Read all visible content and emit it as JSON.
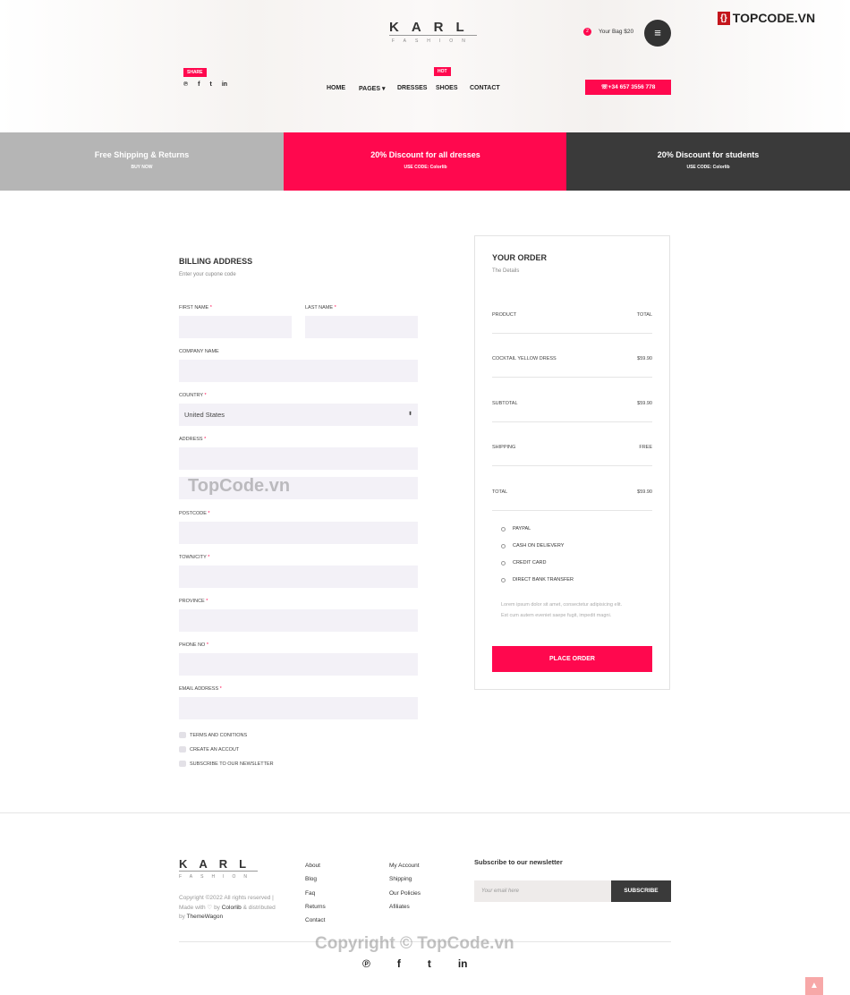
{
  "header": {
    "logo_main": "KARL",
    "logo_sub": "FASHION",
    "share_tag": "SHARE",
    "hot_tag": "HOT",
    "bag_count": "2",
    "bag_label": "Your Bag $20",
    "phone": "+34 657 3556 778",
    "nav": [
      "HOME",
      "PAGES",
      "DRESSES",
      "SHOES",
      "CONTACT"
    ],
    "social_icons": [
      "pinterest-icon",
      "facebook-icon",
      "twitter-icon",
      "linkedin-icon"
    ]
  },
  "banners": [
    {
      "title": "Free Shipping & Returns",
      "sub": "BUY NOW",
      "color": "#b5b5b5"
    },
    {
      "title": "20% Discount for all dresses",
      "sub": "USE CODE: Colorlib",
      "color": "#ff084e"
    },
    {
      "title": "20% Discount for students",
      "sub": "USE CODE: Colorlib",
      "color": "#3a3a3a"
    }
  ],
  "billing": {
    "title": "BILLING ADDRESS",
    "subtitle": "Enter your cupone code",
    "first_name": "FIRST NAME",
    "last_name": "LAST NAME",
    "company": "COMPANY NAME",
    "country": "COUNTRY",
    "country_value": "United States",
    "address": "ADDRESS",
    "postcode": "POSTCODE",
    "town": "TOWN/CITY",
    "province": "PROVINCE",
    "phone": "PHONE NO",
    "email": "EMAIL ADDRESS",
    "required": "*",
    "checkboxes": [
      "TERMS AND CONITIONS",
      "CREATE AN ACCOUT",
      "SUBSCRIBE TO OUR NEWSLETTER"
    ]
  },
  "order": {
    "title": "YOUR ORDER",
    "subtitle": "The Details",
    "rows": [
      [
        "PRODUCT",
        "TOTAL"
      ],
      [
        "COCKTAIL YELLOW DRESS",
        "$59.90"
      ],
      [
        "SUBTOTAL",
        "$59.90"
      ],
      [
        "SHIPPING",
        "FREE"
      ],
      [
        "TOTAL",
        "$59.90"
      ]
    ],
    "payments": [
      "PAYPAL",
      "CASH ON DELIEVERY",
      "CREDIT CARD",
      "DIRECT BANK TRANSFER"
    ],
    "note1": "Lorem ipsum dolor sit amet, consectetur adipisicing elit.",
    "note2": "Est cum autem eveniet saepe fugit, impedit magni.",
    "button": "PLACE ORDER"
  },
  "footer": {
    "copyright1": "Copyright ©2022 All rights reserved |",
    "copyright2a": "Made with ♡ by ",
    "colorlib": "Colorlib",
    "copyright2b": " & distributed",
    "copyright3a": "by ",
    "themewagon": "ThemeWagon",
    "col1": [
      "About",
      "Blog",
      "Faq",
      "Returns",
      "Contact"
    ],
    "col2": [
      "My Account",
      "Shipping",
      "Our Policies",
      "Afiliates"
    ],
    "newsletter_title": "Subscribe to our newsletter",
    "email_placeholder": "Your email here",
    "subscribe": "SUBSCRIBE"
  },
  "watermarks": {
    "brand": "TOPCODE.VN",
    "mid": "TopCode.vn",
    "bottom": "Copyright © TopCode.vn"
  },
  "accent": "#ff084e"
}
